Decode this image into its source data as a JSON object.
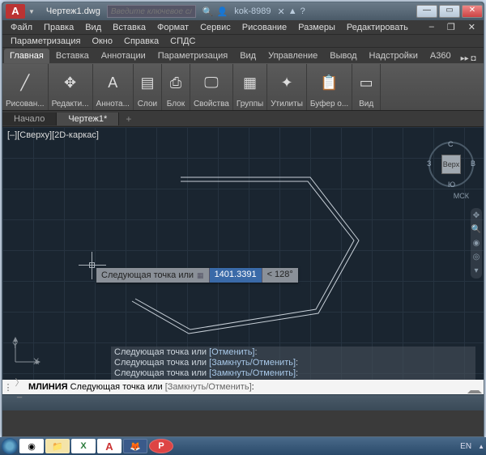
{
  "title": "Чертеж1.dwg",
  "search_placeholder": "Введите ключевое слово/фразу",
  "user": "kok-8989",
  "menu1": [
    "Файл",
    "Правка",
    "Вид",
    "Вставка",
    "Формат",
    "Сервис",
    "Рисование",
    "Размеры",
    "Редактировать"
  ],
  "menu2": [
    "Параметризация",
    "Окно",
    "Справка",
    "СПДС"
  ],
  "ribbon_tabs": [
    "Главная",
    "Вставка",
    "Аннотации",
    "Параметризация",
    "Вид",
    "Управление",
    "Вывод",
    "Надстройки",
    "A360"
  ],
  "ribbon_panels": [
    {
      "label": "Рисован...",
      "icon": "╱"
    },
    {
      "label": "Редакти...",
      "icon": "✥"
    },
    {
      "label": "Аннота...",
      "icon": "A"
    },
    {
      "label": "Слои",
      "icon": "▤"
    },
    {
      "label": "Блок",
      "icon": "⎙"
    },
    {
      "label": "Свойства",
      "icon": "🖵"
    },
    {
      "label": "Группы",
      "icon": "▦"
    },
    {
      "label": "Утилиты",
      "icon": "✦"
    },
    {
      "label": "Буфер о...",
      "icon": "📋"
    },
    {
      "label": "Вид",
      "icon": "▭"
    }
  ],
  "doc_tabs": [
    {
      "label": "Начало",
      "active": false
    },
    {
      "label": "Чертеж1*",
      "active": true
    }
  ],
  "view_label": "[–][Сверху][2D-каркас]",
  "viewcube": {
    "face": "Верх",
    "n": "С",
    "s": "Ю",
    "e": "В",
    "w": "З"
  },
  "wcs": "МСК",
  "dyn_prompt": "Следующая точка или",
  "dyn_value": "1401.3391",
  "dyn_angle": "< 128°",
  "history": [
    {
      "t": "Следующая точка или ",
      "b": "[Отменить]",
      "e": ":"
    },
    {
      "t": "Следующая точка или ",
      "b": "[Замкнуть/Отменить]",
      "e": ":"
    },
    {
      "t": "Следующая точка или ",
      "b": "[Замкнуть/Отменить]",
      "e": ":"
    }
  ],
  "cmd_prefix": "МЛИНИЯ ",
  "cmd_text": "Следующая точка или ",
  "cmd_bracket": "[Замкнуть/Отменить]",
  "cmd_suffix": ":",
  "axes": {
    "x": "X",
    "y": "Y"
  },
  "lang": "EN",
  "taskbar": {
    "excel": "X",
    "acad": "A",
    "p": "P"
  }
}
